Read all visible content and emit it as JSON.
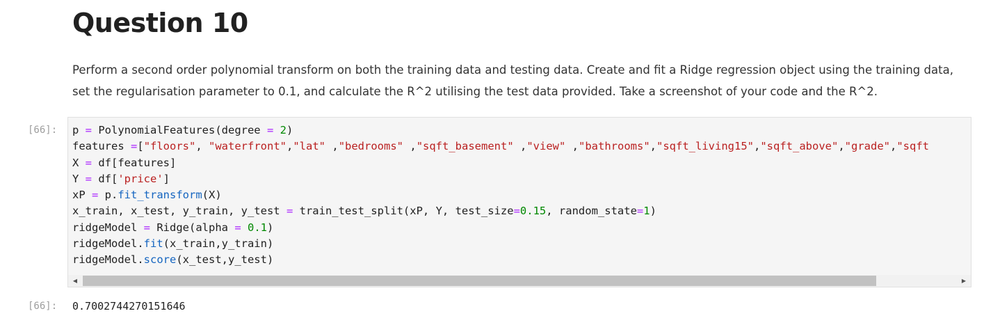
{
  "heading": "Question 10",
  "description": "Perform a second order polynomial transform on both the training data and testing data. Create and fit a Ridge regression object using the training data, set the regularisation parameter to 0.1, and calculate the R^2 utilising the test data provided. Take a screenshot of your code and the R^2.",
  "input_prompt": "[66]:",
  "output_prompt": "[66]:",
  "code_lines": [
    "p = PolynomialFeatures(degree = 2)",
    "features =[\"floors\", \"waterfront\",\"lat\" ,\"bedrooms\" ,\"sqft_basement\" ,\"view\" ,\"bathrooms\",\"sqft_living15\",\"sqft_above\",\"grade\",\"sqft",
    "X = df[features]",
    "Y = df['price']",
    "xP = p.fit_transform(X)",
    "x_train, x_test, y_train, y_test = train_test_split(xP, Y, test_size=0.15, random_state=1)",
    "ridgeModel = Ridge(alpha = 0.1)",
    "ridgeModel.fit(x_train,y_train)",
    "ridgeModel.score(x_test,y_test)"
  ],
  "output_value": "0.7002744270151646",
  "scroll_position": 0.0,
  "icons": {
    "scroll_left": "triangle-left-icon",
    "scroll_right": "triangle-right-icon"
  },
  "colors": {
    "keyword_operator": "#aa22ff",
    "number": "#008800",
    "string": "#ba2121",
    "function": "#1565c0",
    "prompt": "#9e9e9e"
  }
}
